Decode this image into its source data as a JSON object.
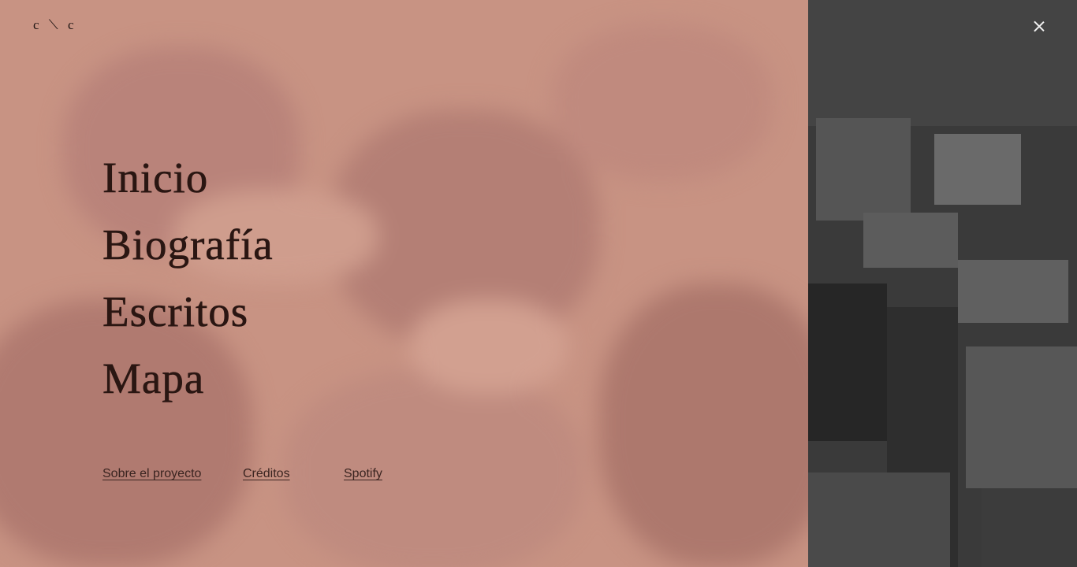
{
  "logo": {
    "text": "c ⟍ c"
  },
  "close": {
    "icon": "close-icon"
  },
  "nav": {
    "items": [
      {
        "label": "Inicio"
      },
      {
        "label": "Biografía"
      },
      {
        "label": "Escritos"
      },
      {
        "label": "Mapa"
      }
    ]
  },
  "footer": {
    "links": [
      {
        "label": "Sobre el proyecto"
      },
      {
        "label": "Créditos"
      },
      {
        "label": "Spotify"
      }
    ]
  },
  "colors": {
    "overlay": "#c89383",
    "text": "#2a1612",
    "photo_dark": "#3a3a3a",
    "close_icon": "#f2f2f2"
  }
}
